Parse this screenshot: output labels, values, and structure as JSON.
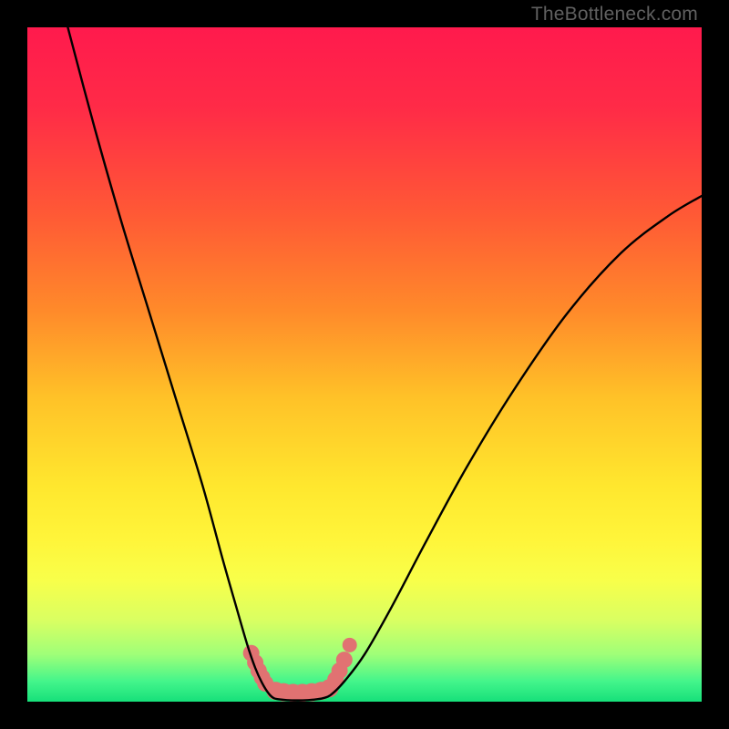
{
  "watermark": "TheBottleneck.com",
  "chart_data": {
    "type": "line",
    "title": "",
    "xlabel": "",
    "ylabel": "",
    "xlim": [
      0,
      1
    ],
    "ylim": [
      0,
      1
    ],
    "gradient_stops": [
      {
        "offset": 0.0,
        "color": "#ff1a4d"
      },
      {
        "offset": 0.12,
        "color": "#ff2b47"
      },
      {
        "offset": 0.28,
        "color": "#ff5a35"
      },
      {
        "offset": 0.42,
        "color": "#ff8a2a"
      },
      {
        "offset": 0.55,
        "color": "#ffc228"
      },
      {
        "offset": 0.68,
        "color": "#ffe72e"
      },
      {
        "offset": 0.76,
        "color": "#fff53a"
      },
      {
        "offset": 0.82,
        "color": "#f8ff4a"
      },
      {
        "offset": 0.88,
        "color": "#d9ff62"
      },
      {
        "offset": 0.93,
        "color": "#9fff78"
      },
      {
        "offset": 0.97,
        "color": "#44f58b"
      },
      {
        "offset": 1.0,
        "color": "#16e07a"
      }
    ],
    "series": [
      {
        "name": "left-curve",
        "x": [
          0.06,
          0.1,
          0.14,
          0.18,
          0.22,
          0.26,
          0.29,
          0.31,
          0.326,
          0.338,
          0.348,
          0.358,
          0.366
        ],
        "y": [
          1.0,
          0.85,
          0.71,
          0.58,
          0.45,
          0.32,
          0.21,
          0.14,
          0.085,
          0.05,
          0.028,
          0.012,
          0.005
        ]
      },
      {
        "name": "valley-floor",
        "x": [
          0.366,
          0.378,
          0.392,
          0.408,
          0.424,
          0.438,
          0.45
        ],
        "y": [
          0.005,
          0.003,
          0.002,
          0.002,
          0.003,
          0.005,
          0.01
        ]
      },
      {
        "name": "right-curve",
        "x": [
          0.45,
          0.47,
          0.5,
          0.54,
          0.59,
          0.65,
          0.72,
          0.8,
          0.88,
          0.95,
          1.0
        ],
        "y": [
          0.01,
          0.03,
          0.07,
          0.14,
          0.235,
          0.345,
          0.46,
          0.575,
          0.665,
          0.72,
          0.75
        ]
      }
    ],
    "markers": {
      "color": "#e17272",
      "groups": [
        {
          "name": "left-cluster",
          "points": [
            {
              "x": 0.332,
              "y": 0.072,
              "r": 9
            },
            {
              "x": 0.338,
              "y": 0.058,
              "r": 9
            },
            {
              "x": 0.343,
              "y": 0.046,
              "r": 9
            },
            {
              "x": 0.348,
              "y": 0.036,
              "r": 9
            },
            {
              "x": 0.353,
              "y": 0.027,
              "r": 9
            }
          ]
        },
        {
          "name": "floor-cluster",
          "points": [
            {
              "x": 0.368,
              "y": 0.016,
              "r": 10
            },
            {
              "x": 0.38,
              "y": 0.014,
              "r": 10
            },
            {
              "x": 0.394,
              "y": 0.013,
              "r": 10
            },
            {
              "x": 0.408,
              "y": 0.013,
              "r": 10
            },
            {
              "x": 0.422,
              "y": 0.014,
              "r": 10
            },
            {
              "x": 0.436,
              "y": 0.016,
              "r": 10
            },
            {
              "x": 0.448,
              "y": 0.02,
              "r": 10
            }
          ]
        },
        {
          "name": "right-cluster",
          "points": [
            {
              "x": 0.457,
              "y": 0.033,
              "r": 9
            },
            {
              "x": 0.463,
              "y": 0.046,
              "r": 9
            },
            {
              "x": 0.47,
              "y": 0.062,
              "r": 9
            },
            {
              "x": 0.478,
              "y": 0.084,
              "r": 8
            }
          ]
        }
      ]
    }
  }
}
